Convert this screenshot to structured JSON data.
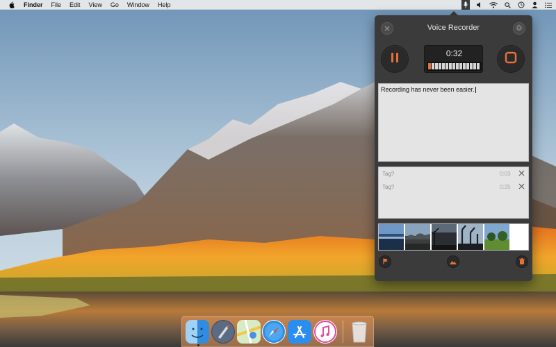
{
  "menubar": {
    "apple_icon": "apple-icon",
    "items": [
      "Finder",
      "File",
      "Edit",
      "View",
      "Go",
      "Window",
      "Help"
    ],
    "status_icons": [
      "microphone-icon",
      "volume-icon",
      "wifi-icon",
      "search-icon",
      "time-machine-icon",
      "user-icon",
      "list-icon"
    ]
  },
  "recorder": {
    "title": "Voice Recorder",
    "close_icon": "close-icon",
    "settings_icon": "gear-icon",
    "pause_icon": "pause-icon",
    "stop_icon": "stop-icon",
    "timer": "0:32",
    "level_fraction": 0.05,
    "accent_color": "#e2713a",
    "notes_text": "Recording has never been easier.",
    "tags": [
      {
        "label": "Tag?",
        "time": "0:03"
      },
      {
        "label": "Tag?",
        "time": "0:25"
      }
    ],
    "photo_count": 5,
    "footer_icons": [
      "flag-icon",
      "image-icon",
      "trash-icon"
    ]
  },
  "dock": {
    "apps": [
      "finder-icon",
      "launchpad-icon",
      "maps-icon",
      "safari-icon",
      "app-store-icon",
      "itunes-icon",
      "trash-icon"
    ]
  }
}
